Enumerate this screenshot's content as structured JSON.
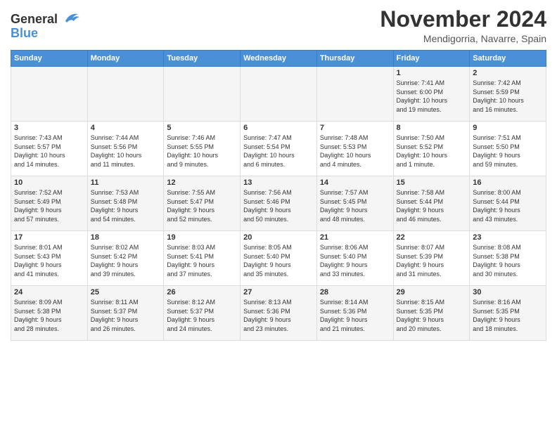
{
  "logo": {
    "line1": "General",
    "line2": "Blue"
  },
  "title": "November 2024",
  "subtitle": "Mendigorria, Navarre, Spain",
  "headers": [
    "Sunday",
    "Monday",
    "Tuesday",
    "Wednesday",
    "Thursday",
    "Friday",
    "Saturday"
  ],
  "weeks": [
    [
      {
        "day": "",
        "info": ""
      },
      {
        "day": "",
        "info": ""
      },
      {
        "day": "",
        "info": ""
      },
      {
        "day": "",
        "info": ""
      },
      {
        "day": "",
        "info": ""
      },
      {
        "day": "1",
        "info": "Sunrise: 7:41 AM\nSunset: 6:00 PM\nDaylight: 10 hours\nand 19 minutes."
      },
      {
        "day": "2",
        "info": "Sunrise: 7:42 AM\nSunset: 5:59 PM\nDaylight: 10 hours\nand 16 minutes."
      }
    ],
    [
      {
        "day": "3",
        "info": "Sunrise: 7:43 AM\nSunset: 5:57 PM\nDaylight: 10 hours\nand 14 minutes."
      },
      {
        "day": "4",
        "info": "Sunrise: 7:44 AM\nSunset: 5:56 PM\nDaylight: 10 hours\nand 11 minutes."
      },
      {
        "day": "5",
        "info": "Sunrise: 7:46 AM\nSunset: 5:55 PM\nDaylight: 10 hours\nand 9 minutes."
      },
      {
        "day": "6",
        "info": "Sunrise: 7:47 AM\nSunset: 5:54 PM\nDaylight: 10 hours\nand 6 minutes."
      },
      {
        "day": "7",
        "info": "Sunrise: 7:48 AM\nSunset: 5:53 PM\nDaylight: 10 hours\nand 4 minutes."
      },
      {
        "day": "8",
        "info": "Sunrise: 7:50 AM\nSunset: 5:52 PM\nDaylight: 10 hours\nand 1 minute."
      },
      {
        "day": "9",
        "info": "Sunrise: 7:51 AM\nSunset: 5:50 PM\nDaylight: 9 hours\nand 59 minutes."
      }
    ],
    [
      {
        "day": "10",
        "info": "Sunrise: 7:52 AM\nSunset: 5:49 PM\nDaylight: 9 hours\nand 57 minutes."
      },
      {
        "day": "11",
        "info": "Sunrise: 7:53 AM\nSunset: 5:48 PM\nDaylight: 9 hours\nand 54 minutes."
      },
      {
        "day": "12",
        "info": "Sunrise: 7:55 AM\nSunset: 5:47 PM\nDaylight: 9 hours\nand 52 minutes."
      },
      {
        "day": "13",
        "info": "Sunrise: 7:56 AM\nSunset: 5:46 PM\nDaylight: 9 hours\nand 50 minutes."
      },
      {
        "day": "14",
        "info": "Sunrise: 7:57 AM\nSunset: 5:45 PM\nDaylight: 9 hours\nand 48 minutes."
      },
      {
        "day": "15",
        "info": "Sunrise: 7:58 AM\nSunset: 5:44 PM\nDaylight: 9 hours\nand 46 minutes."
      },
      {
        "day": "16",
        "info": "Sunrise: 8:00 AM\nSunset: 5:44 PM\nDaylight: 9 hours\nand 43 minutes."
      }
    ],
    [
      {
        "day": "17",
        "info": "Sunrise: 8:01 AM\nSunset: 5:43 PM\nDaylight: 9 hours\nand 41 minutes."
      },
      {
        "day": "18",
        "info": "Sunrise: 8:02 AM\nSunset: 5:42 PM\nDaylight: 9 hours\nand 39 minutes."
      },
      {
        "day": "19",
        "info": "Sunrise: 8:03 AM\nSunset: 5:41 PM\nDaylight: 9 hours\nand 37 minutes."
      },
      {
        "day": "20",
        "info": "Sunrise: 8:05 AM\nSunset: 5:40 PM\nDaylight: 9 hours\nand 35 minutes."
      },
      {
        "day": "21",
        "info": "Sunrise: 8:06 AM\nSunset: 5:40 PM\nDaylight: 9 hours\nand 33 minutes."
      },
      {
        "day": "22",
        "info": "Sunrise: 8:07 AM\nSunset: 5:39 PM\nDaylight: 9 hours\nand 31 minutes."
      },
      {
        "day": "23",
        "info": "Sunrise: 8:08 AM\nSunset: 5:38 PM\nDaylight: 9 hours\nand 30 minutes."
      }
    ],
    [
      {
        "day": "24",
        "info": "Sunrise: 8:09 AM\nSunset: 5:38 PM\nDaylight: 9 hours\nand 28 minutes."
      },
      {
        "day": "25",
        "info": "Sunrise: 8:11 AM\nSunset: 5:37 PM\nDaylight: 9 hours\nand 26 minutes."
      },
      {
        "day": "26",
        "info": "Sunrise: 8:12 AM\nSunset: 5:37 PM\nDaylight: 9 hours\nand 24 minutes."
      },
      {
        "day": "27",
        "info": "Sunrise: 8:13 AM\nSunset: 5:36 PM\nDaylight: 9 hours\nand 23 minutes."
      },
      {
        "day": "28",
        "info": "Sunrise: 8:14 AM\nSunset: 5:36 PM\nDaylight: 9 hours\nand 21 minutes."
      },
      {
        "day": "29",
        "info": "Sunrise: 8:15 AM\nSunset: 5:35 PM\nDaylight: 9 hours\nand 20 minutes."
      },
      {
        "day": "30",
        "info": "Sunrise: 8:16 AM\nSunset: 5:35 PM\nDaylight: 9 hours\nand 18 minutes."
      }
    ]
  ]
}
